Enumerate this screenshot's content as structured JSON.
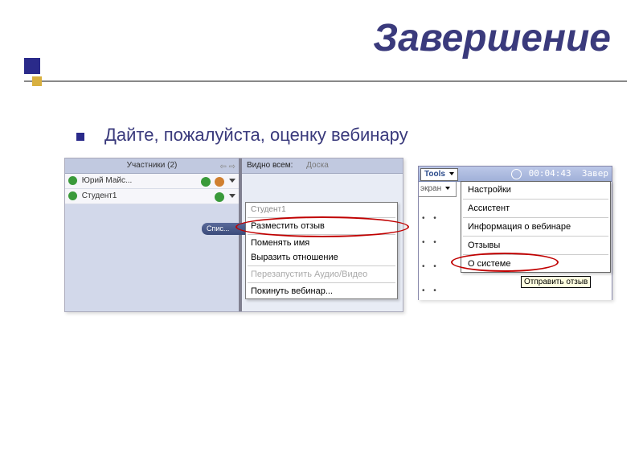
{
  "slide": {
    "title": "Завершение",
    "subtitle": "Дайте, пожалуйста, оценку вебинару"
  },
  "shot1": {
    "participants_header": "Участники (2)",
    "row1_name": "Юрий Майс...",
    "row2_name": "Студент1",
    "list_button": "Спис...",
    "visible_label": "Видно всем:",
    "visible_value": "Доска",
    "ctx": {
      "title": "Студент1",
      "item1": "Разместить отзыв",
      "item2": "Поменять имя",
      "item3": "Выразить отношение",
      "item4": "Перезапустить Аудио/Видео",
      "item5": "Покинуть вебинар..."
    }
  },
  "shot2": {
    "tools_label": "Tools",
    "time": "00:04:43",
    "time_suffix": "Завер",
    "side_label": "экран",
    "menu": {
      "m1": "Настройки",
      "m2": "Ассистент",
      "m3": "Информация о вебинаре",
      "m4": "Отзывы",
      "m5": "О системе"
    },
    "tooltip": "Отправить отзыв"
  }
}
